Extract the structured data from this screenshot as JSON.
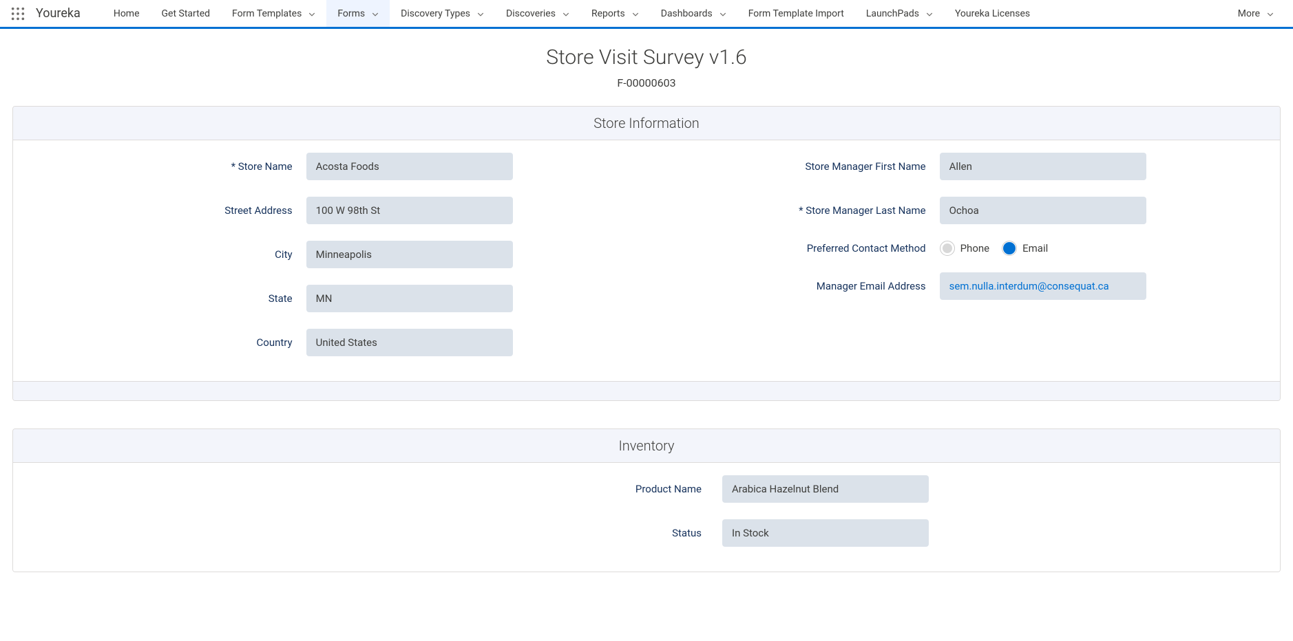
{
  "brand": "Youreka",
  "nav": [
    {
      "label": "Home",
      "dropdown": false
    },
    {
      "label": "Get Started",
      "dropdown": false
    },
    {
      "label": "Form Templates",
      "dropdown": true
    },
    {
      "label": "Forms",
      "dropdown": true,
      "active": true
    },
    {
      "label": "Discovery Types",
      "dropdown": true
    },
    {
      "label": "Discoveries",
      "dropdown": true
    },
    {
      "label": "Reports",
      "dropdown": true
    },
    {
      "label": "Dashboards",
      "dropdown": true
    },
    {
      "label": "Form Template Import",
      "dropdown": false
    },
    {
      "label": "LaunchPads",
      "dropdown": true
    },
    {
      "label": "Youreka Licenses",
      "dropdown": false
    }
  ],
  "more_label": "More",
  "page": {
    "title": "Store Visit Survey v1.6",
    "record_id": "F-00000603"
  },
  "sections": {
    "store_info": {
      "title": "Store Information",
      "left": [
        {
          "label": "* Store Name",
          "value": "Acosta Foods"
        },
        {
          "label": "Street Address",
          "value": "100 W 98th St"
        },
        {
          "label": "City",
          "value": "Minneapolis"
        },
        {
          "label": "State",
          "value": "MN"
        },
        {
          "label": "Country",
          "value": "United States"
        }
      ],
      "right": [
        {
          "label": "Store Manager First Name",
          "value": "Allen",
          "type": "text"
        },
        {
          "label": "* Store Manager Last Name",
          "value": "Ochoa",
          "type": "text"
        },
        {
          "label": "Preferred Contact Method",
          "type": "radio",
          "options": [
            {
              "label": "Phone",
              "selected": false
            },
            {
              "label": "Email",
              "selected": true
            }
          ]
        },
        {
          "label": "Manager Email Address",
          "value": "sem.nulla.interdum@consequat.ca",
          "type": "link"
        }
      ]
    },
    "inventory": {
      "title": "Inventory",
      "rows": [
        {
          "label": "Product Name",
          "value": "Arabica Hazelnut Blend"
        },
        {
          "label": "Status",
          "value": "In Stock"
        }
      ]
    }
  }
}
